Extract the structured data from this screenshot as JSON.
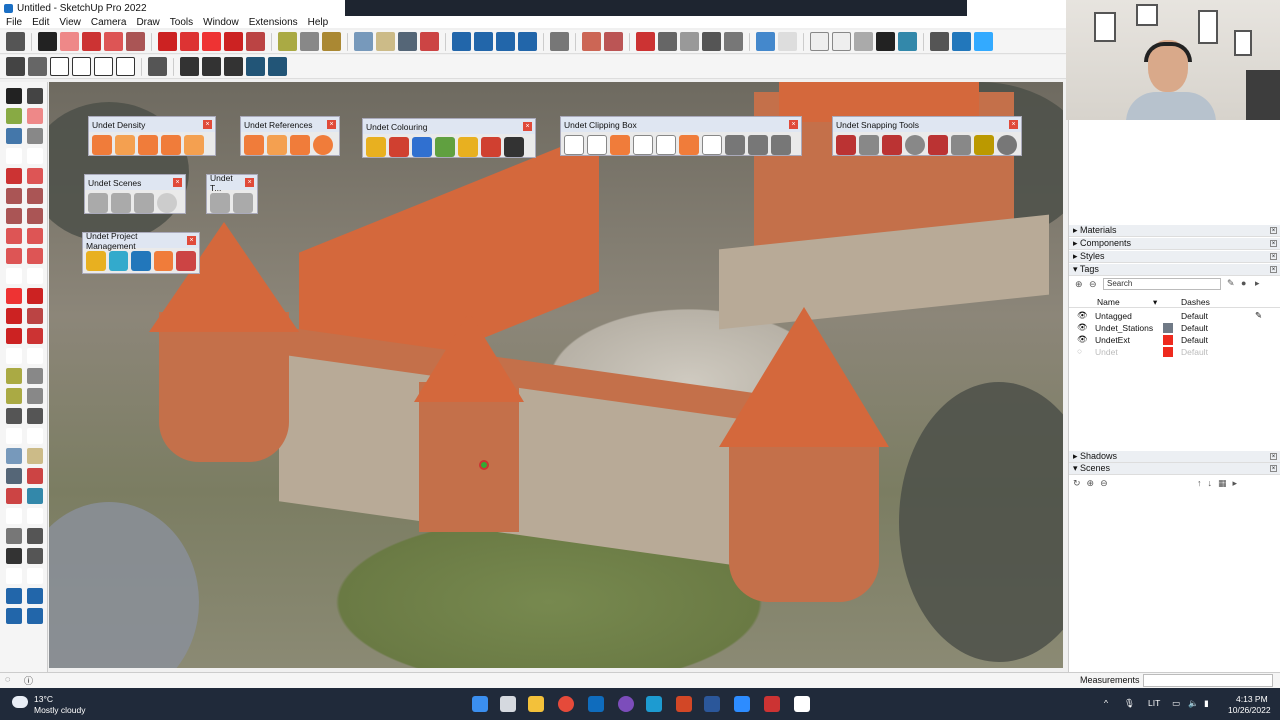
{
  "window": {
    "title": "Untitled - SketchUp Pro 2022"
  },
  "menu": [
    "File",
    "Edit",
    "View",
    "Camera",
    "Draw",
    "Tools",
    "Window",
    "Extensions",
    "Help"
  ],
  "panels": {
    "density": "Undet Density",
    "references": "Undet References",
    "colouring": "Undet Colouring",
    "clipping": "Undet Clipping Box",
    "snapping": "Undet Snapping Tools",
    "scenes": "Undet Scenes",
    "undet_t": "Undet T...",
    "project": "Undet Project Management"
  },
  "tray": {
    "sections": [
      "Materials",
      "Components",
      "Styles",
      "Tags",
      "Shadows",
      "Scenes"
    ],
    "search_placeholder": "Search",
    "columns": {
      "name": "Name",
      "dashes": "Dashes"
    },
    "tags": [
      {
        "name": "Untagged",
        "dashes": "Default",
        "color": ""
      },
      {
        "name": "Undet_Stations",
        "dashes": "Default",
        "color": "#707a86"
      },
      {
        "name": "UndetExt",
        "dashes": "Default",
        "color": "#ee2a1e"
      },
      {
        "name": "Undet",
        "dashes": "Default",
        "color": "#ee2a1e"
      }
    ]
  },
  "status": {
    "measurements": "Measurements"
  },
  "taskbar": {
    "weather_temp": "13°C",
    "weather_desc": "Mostly cloudy",
    "lang": "LIT",
    "time": "4:13 PM",
    "date": "10/26/2022"
  }
}
